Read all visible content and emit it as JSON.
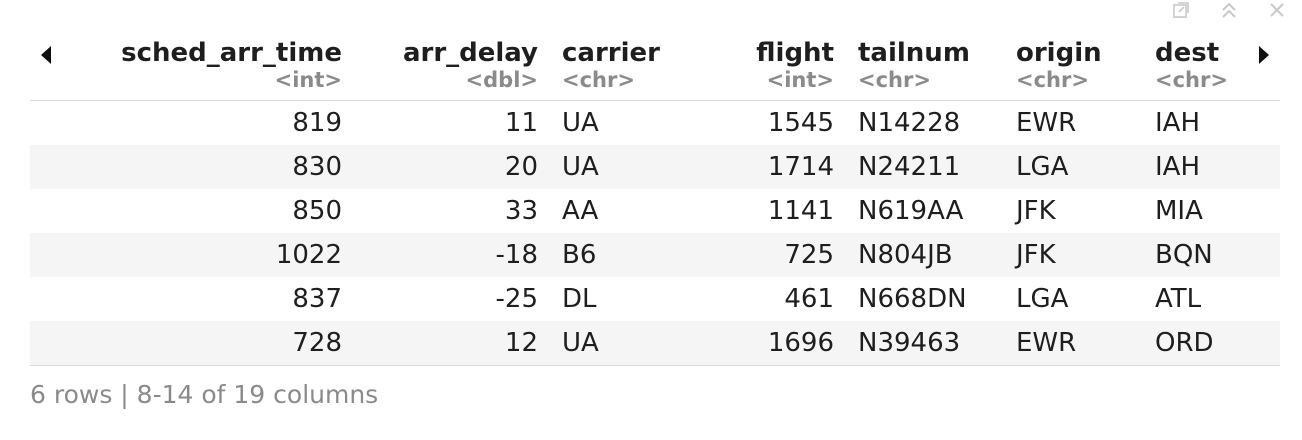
{
  "columns": [
    {
      "name": "sched_arr_time",
      "type": "<int>"
    },
    {
      "name": "arr_delay",
      "type": "<dbl>"
    },
    {
      "name": "carrier",
      "type": "<chr>"
    },
    {
      "name": "flight",
      "type": "<int>"
    },
    {
      "name": "tailnum",
      "type": "<chr>"
    },
    {
      "name": "origin",
      "type": "<chr>"
    },
    {
      "name": "dest",
      "type": "<chr>"
    }
  ],
  "rows": [
    [
      "819",
      "11",
      "UA",
      "1545",
      "N14228",
      "EWR",
      "IAH"
    ],
    [
      "830",
      "20",
      "UA",
      "1714",
      "N24211",
      "LGA",
      "IAH"
    ],
    [
      "850",
      "33",
      "AA",
      "1141",
      "N619AA",
      "JFK",
      "MIA"
    ],
    [
      "1022",
      "-18",
      "B6",
      "725",
      "N804JB",
      "JFK",
      "BQN"
    ],
    [
      "837",
      "-25",
      "DL",
      "461",
      "N668DN",
      "LGA",
      "ATL"
    ],
    [
      "728",
      "12",
      "UA",
      "1696",
      "N39463",
      "EWR",
      "ORD"
    ]
  ],
  "footer": "6 rows | 8-14 of 19 columns",
  "toolbar": {
    "icons": [
      "export-icon",
      "collapse-icon",
      "close-icon"
    ]
  },
  "nav": {
    "prev_icon": "triangle-left-icon",
    "next_icon": "triangle-right-icon"
  },
  "colors": {
    "header_text": "#1e1e1e",
    "type_text": "#8a8a8a",
    "stripe": "#f5f5f5",
    "border": "#d9d9d9"
  }
}
